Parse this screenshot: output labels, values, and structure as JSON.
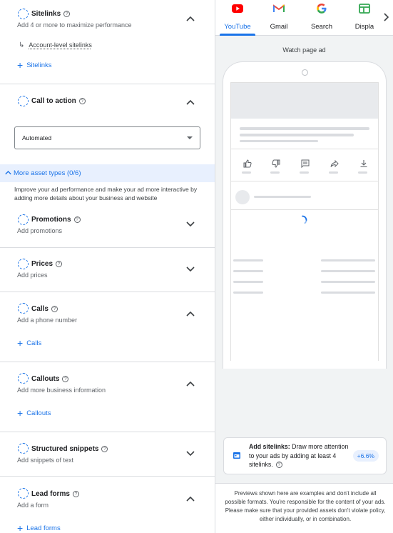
{
  "left_panel": {
    "sitelinks": {
      "title": "Sitelinks",
      "subtitle": "Add 4 or more to maximize performance",
      "account_link": "Account-level sitelinks",
      "add_label": "Sitelinks"
    },
    "call_to_action": {
      "title": "Call to action",
      "select_value": "Automated"
    },
    "more_asset_types": {
      "label": "More asset types (0/6)",
      "description": "Improve your ad performance and make your ad more interactive by adding more details about your business and website"
    },
    "promotions": {
      "title": "Promotions",
      "subtitle": "Add promotions"
    },
    "prices": {
      "title": "Prices",
      "subtitle": "Add prices"
    },
    "calls": {
      "title": "Calls",
      "subtitle": "Add a phone number",
      "add_label": "Calls"
    },
    "callouts": {
      "title": "Callouts",
      "subtitle": "Add more business information",
      "add_label": "Callouts"
    },
    "structured_snippets": {
      "title": "Structured snippets",
      "subtitle": "Add snippets of text"
    },
    "lead_forms": {
      "title": "Lead forms",
      "subtitle": "Add a form",
      "add_label": "Lead forms"
    }
  },
  "right_panel": {
    "tabs": [
      {
        "label": "YouTube",
        "icon": "youtube-icon",
        "active": true
      },
      {
        "label": "Gmail",
        "icon": "gmail-icon",
        "active": false
      },
      {
        "label": "Search",
        "icon": "google-icon",
        "active": false
      },
      {
        "label": "Displa",
        "icon": "display-icon",
        "active": false
      }
    ],
    "preview_label": "Watch page ad",
    "hint": {
      "bold": "Add sitelinks:",
      "text": "Draw more attention to your ads by adding at least 4 sitelinks.",
      "badge": "+6.6%"
    },
    "disclaimer": "Previews shown here are examples and don't include all possible formats. You're responsible for the content of your ads. Please make sure that your provided assets don't violate policy, either individually, or in combination."
  },
  "colors": {
    "accent": "#1a73e8",
    "highlight_bg": "#e8f0fe",
    "border": "#dadce0",
    "youtube": "#ff0000"
  }
}
